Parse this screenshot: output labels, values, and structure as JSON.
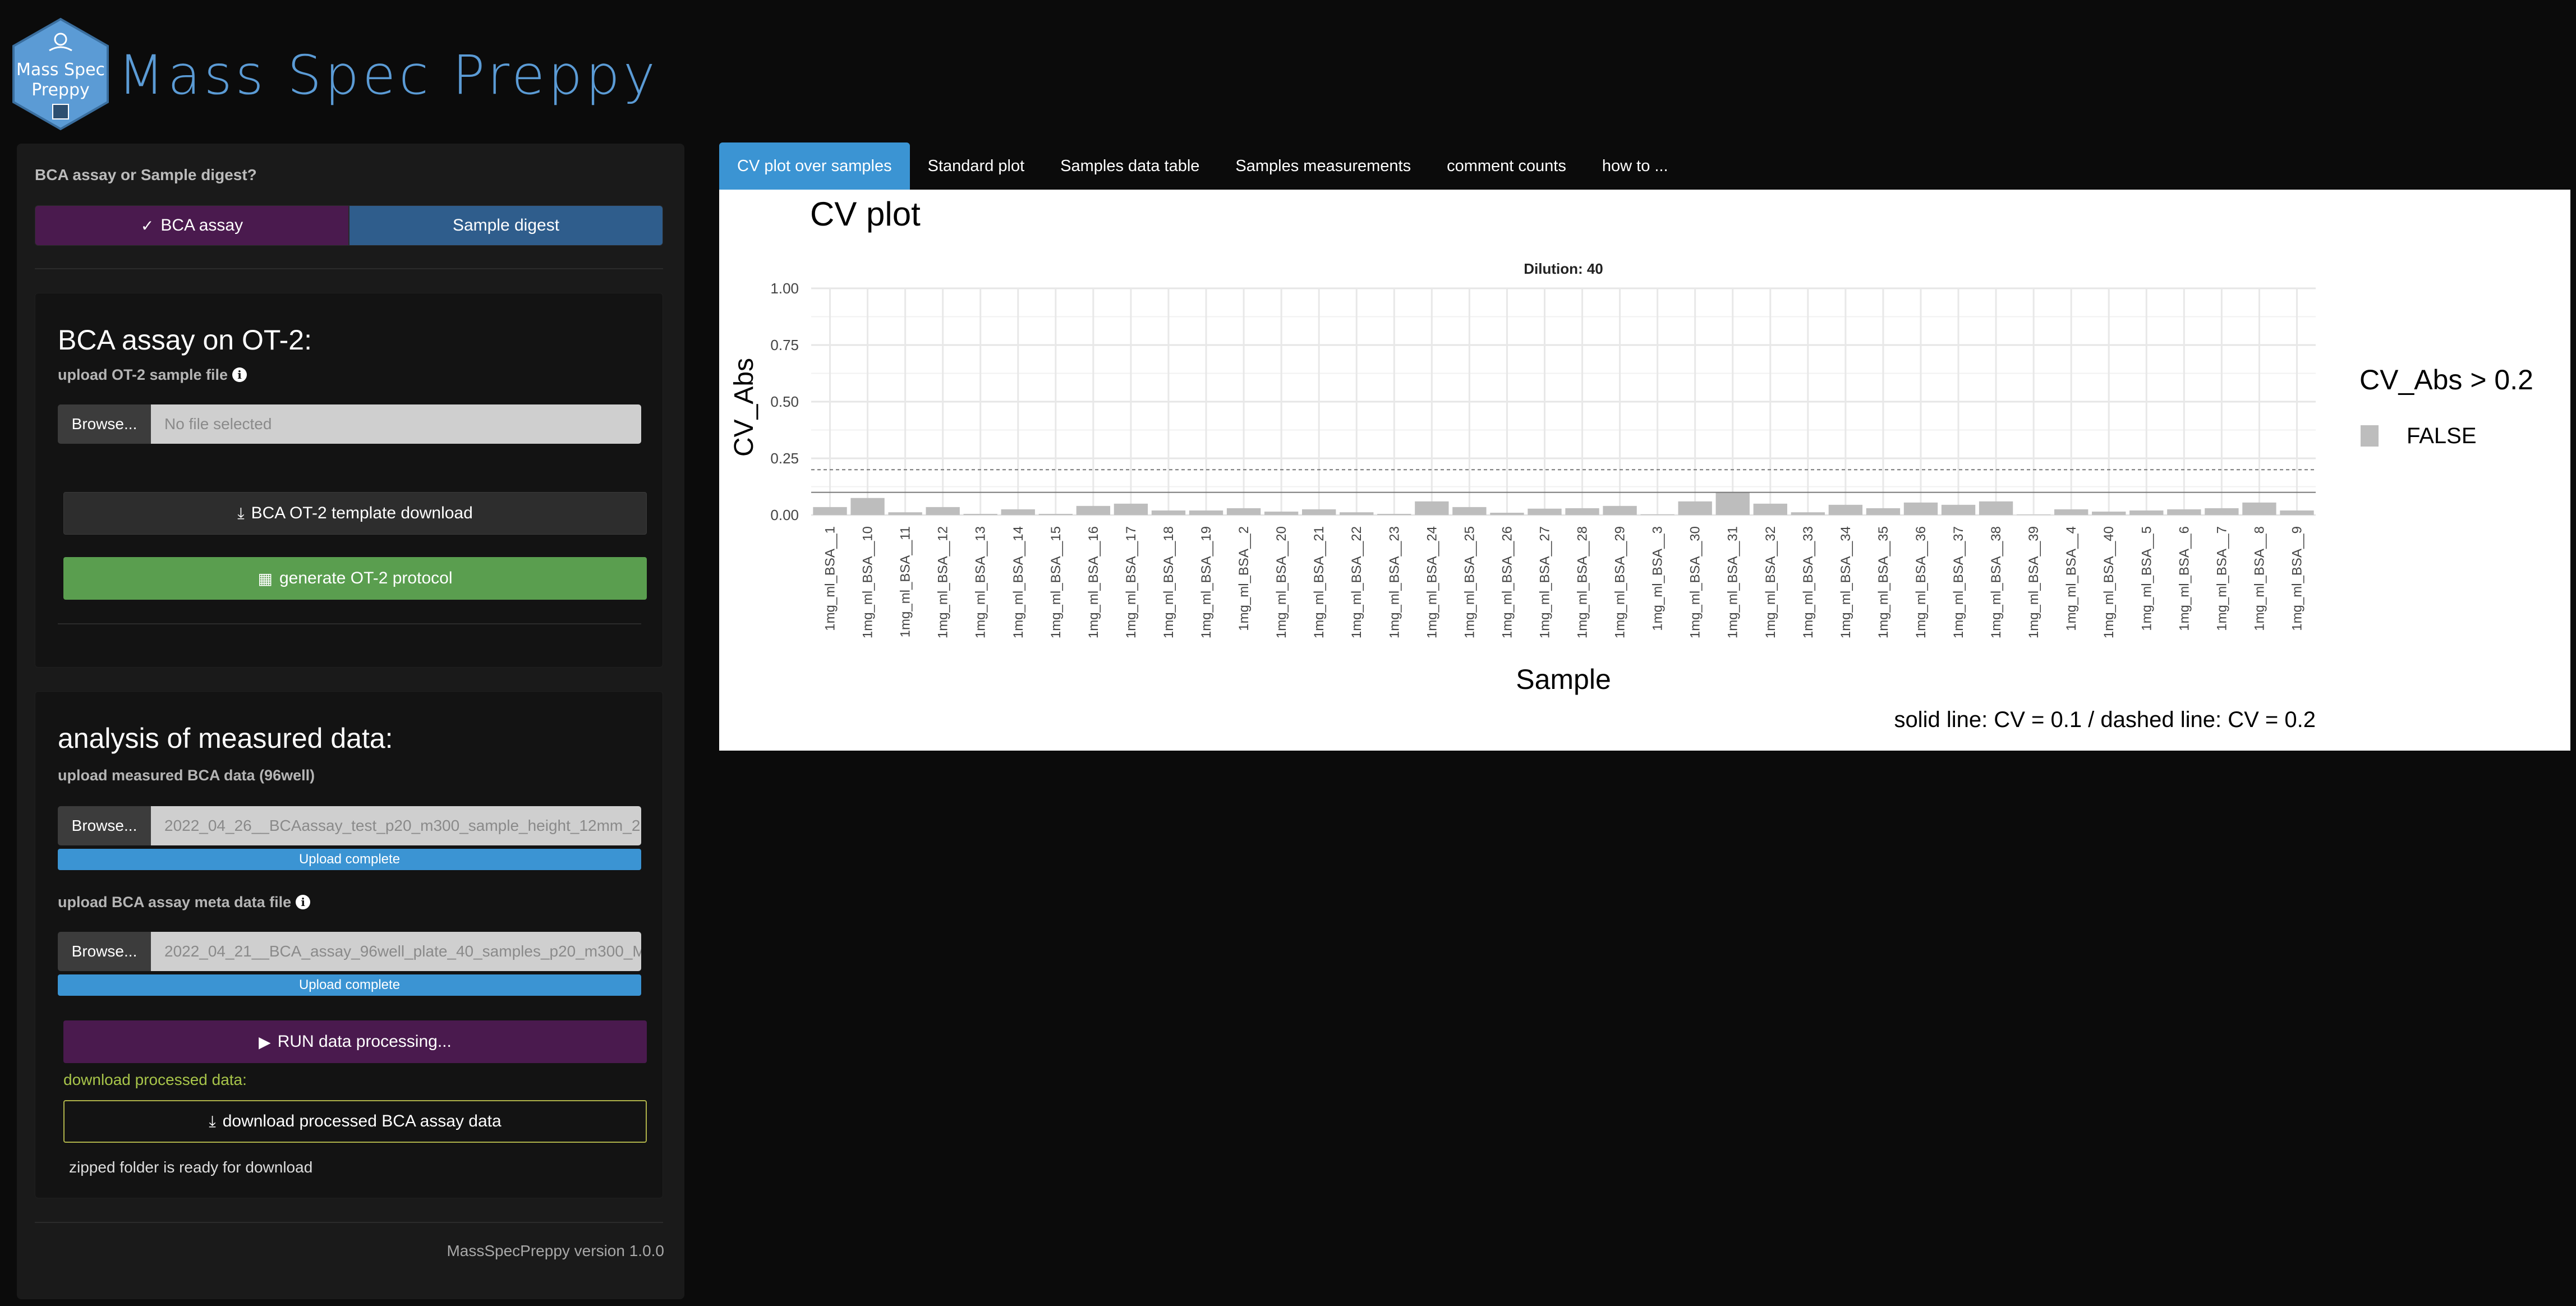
{
  "header": {
    "logo_text_line1": "Mass Spec",
    "logo_text_line2": "Preppy",
    "app_title": "Mass Spec Preppy"
  },
  "sidebar": {
    "question": "BCA assay or Sample digest?",
    "options": [
      {
        "label": "BCA assay",
        "selected": true
      },
      {
        "label": "Sample digest",
        "selected": false
      }
    ],
    "ot2": {
      "title": "BCA assay on OT-2:",
      "upload_label": "upload OT-2 sample file",
      "browse_label": "Browse...",
      "file_placeholder": "No file selected",
      "template_button": "BCA OT-2 template download",
      "generate_button": "generate OT-2 protocol"
    },
    "analysis": {
      "title": "analysis of measured data:",
      "measured_label": "upload measured BCA data (96well)",
      "browse_label": "Browse...",
      "measured_file": "2022_04_26__BCAassay_test_p20_m300_sample_height_12mm_2",
      "measured_progress": "Upload complete",
      "meta_label": "upload BCA assay meta data file",
      "meta_file": "2022_04_21__BCA_assay_96well_plate_40_samples_p20_m300_M",
      "meta_progress": "Upload complete",
      "run_button": "RUN data processing...",
      "download_note": "download processed data:",
      "download_button": "download processed BCA assay data",
      "zip_note": "zipped folder is ready for download"
    },
    "version": "MassSpecPreppy version 1.0.0"
  },
  "tabs": [
    {
      "label": "CV plot over samples",
      "active": true
    },
    {
      "label": "Standard plot",
      "active": false
    },
    {
      "label": "Samples data table",
      "active": false
    },
    {
      "label": "Samples measurements",
      "active": false
    },
    {
      "label": "comment counts",
      "active": false
    },
    {
      "label": "how to ...",
      "active": false
    }
  ],
  "colors": {
    "accent_blue": "#3b94d3",
    "purple": "#4a1a4e",
    "green": "#5a9e4f",
    "bar_gray": "#bdbdbd"
  },
  "chart_data": {
    "type": "bar",
    "title": "CV plot",
    "facet_label": "Dilution: 40",
    "xlabel": "Sample",
    "ylabel": "CV_Abs",
    "ylim": [
      0,
      1.0
    ],
    "yticks": [
      0.0,
      0.25,
      0.5,
      0.75,
      1.0
    ],
    "ytick_labels": [
      "0.00",
      "0.25",
      "0.50",
      "0.75",
      "1.00"
    ],
    "reference_lines": [
      {
        "value": 0.1,
        "style": "solid"
      },
      {
        "value": 0.2,
        "style": "dashed"
      }
    ],
    "caption": "solid line: CV = 0.1 / dashed line: CV = 0.2",
    "legend": {
      "title": "CV_Abs > 0.2",
      "entries": [
        "FALSE"
      ],
      "position": "right"
    },
    "grid": true,
    "categories": [
      "1mg_ml_BSA__1",
      "1mg_ml_BSA__10",
      "1mg_ml_BSA__11",
      "1mg_ml_BSA__12",
      "1mg_ml_BSA__13",
      "1mg_ml_BSA__14",
      "1mg_ml_BSA__15",
      "1mg_ml_BSA__16",
      "1mg_ml_BSA__17",
      "1mg_ml_BSA__18",
      "1mg_ml_BSA__19",
      "1mg_ml_BSA__2",
      "1mg_ml_BSA__20",
      "1mg_ml_BSA__21",
      "1mg_ml_BSA__22",
      "1mg_ml_BSA__23",
      "1mg_ml_BSA__24",
      "1mg_ml_BSA__25",
      "1mg_ml_BSA__26",
      "1mg_ml_BSA__27",
      "1mg_ml_BSA__28",
      "1mg_ml_BSA__29",
      "1mg_ml_BSA__3",
      "1mg_ml_BSA__30",
      "1mg_ml_BSA__31",
      "1mg_ml_BSA__32",
      "1mg_ml_BSA__33",
      "1mg_ml_BSA__34",
      "1mg_ml_BSA__35",
      "1mg_ml_BSA__36",
      "1mg_ml_BSA__37",
      "1mg_ml_BSA__38",
      "1mg_ml_BSA__39",
      "1mg_ml_BSA__4",
      "1mg_ml_BSA__40",
      "1mg_ml_BSA__5",
      "1mg_ml_BSA__6",
      "1mg_ml_BSA__7",
      "1mg_ml_BSA__8",
      "1mg_ml_BSA__9"
    ],
    "values": [
      0.035,
      0.075,
      0.012,
      0.035,
      0.005,
      0.025,
      0.005,
      0.04,
      0.05,
      0.02,
      0.02,
      0.03,
      0.015,
      0.025,
      0.012,
      0.005,
      0.06,
      0.035,
      0.01,
      0.028,
      0.03,
      0.04,
      0.003,
      0.06,
      0.1,
      0.05,
      0.012,
      0.045,
      0.03,
      0.055,
      0.045,
      0.06,
      0.002,
      0.025,
      0.015,
      0.02,
      0.025,
      0.03,
      0.055,
      0.02
    ]
  }
}
